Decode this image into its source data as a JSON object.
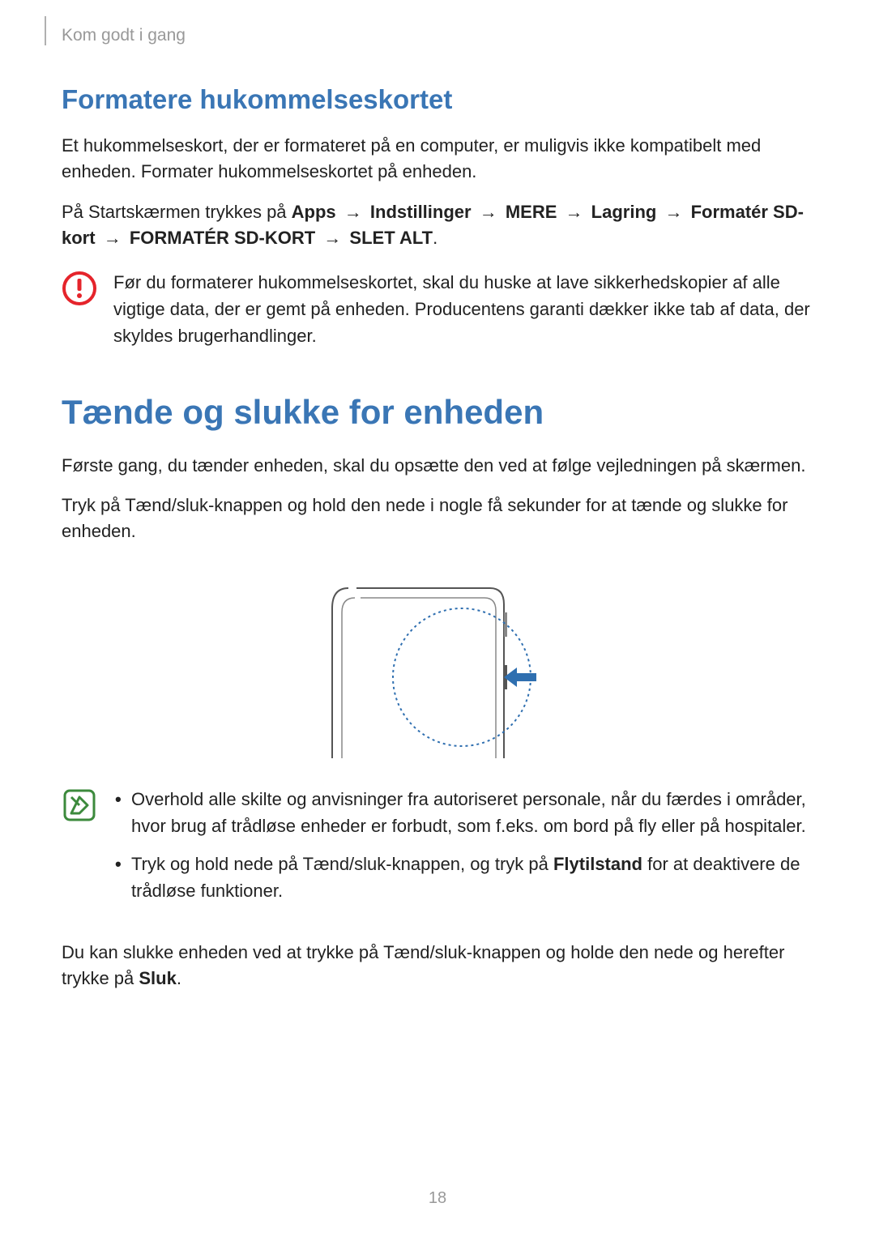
{
  "breadcrumb": "Kom godt i gang",
  "section1": {
    "heading": "Formatere hukommelseskortet",
    "p1": "Et hukommelseskort, der er formateret på en computer, er muligvis ikke kompatibelt med enheden. Formater hukommelseskortet på enheden.",
    "nav_prefix": "På Startskærmen trykkes på ",
    "nav": {
      "apps": "Apps",
      "settings": "Indstillinger",
      "more": "MERE",
      "storage": "Lagring",
      "format_sd": "Formatér SD-kort",
      "format_sd2": "FORMATÉR SD-KORT",
      "delete_all": "SLET ALT"
    },
    "arrow": "→",
    "period": ".",
    "warning": "Før du formaterer hukommelseskortet, skal du huske at lave sikkerhedskopier af alle vigtige data, der er gemt på enheden. Producentens garanti dækker ikke tab af data, der skyldes brugerhandlinger."
  },
  "section2": {
    "heading": "Tænde og slukke for enheden",
    "p1": "Første gang, du tænder enheden, skal du opsætte den ved at følge vejledningen på skærmen.",
    "p2": "Tryk på Tænd/sluk-knappen og hold den nede i nogle få sekunder for at tænde og slukke for enheden.",
    "notes": {
      "item1": "Overhold alle skilte og anvisninger fra autoriseret personale, når du færdes i områder, hvor brug af trådløse enheder er forbudt, som f.eks. om bord på fly eller på hospitaler.",
      "item2_a": "Tryk og hold nede på Tænd/sluk-knappen, og tryk på ",
      "item2_bold": "Flytilstand",
      "item2_b": " for at deaktivere de trådløse funktioner."
    },
    "p3_a": "Du kan slukke enheden ved at trykke på Tænd/sluk-knappen og holde den nede og herefter trykke på ",
    "p3_bold": "Sluk",
    "p3_b": "."
  },
  "page_number": "18"
}
